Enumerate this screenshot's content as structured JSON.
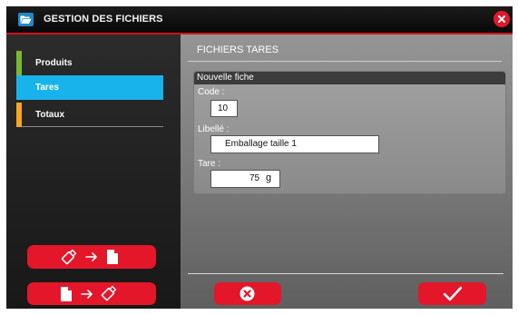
{
  "window": {
    "title": "GESTION DES FICHIERS",
    "icon": "folder-open-icon",
    "close_icon": "close-icon"
  },
  "sidebar": {
    "items": [
      {
        "label": "Produits",
        "accent": "#7ab82f",
        "active": false
      },
      {
        "label": "Tares",
        "accent": "#18b3eb",
        "active": true
      },
      {
        "label": "Totaux",
        "accent": "#f5a623",
        "active": false
      }
    ],
    "buttons": [
      {
        "name": "import-from-usb",
        "icons": [
          "usb-stick-icon",
          "arrow-right-icon",
          "document-icon"
        ]
      },
      {
        "name": "export-to-usb",
        "icons": [
          "document-icon",
          "arrow-right-icon",
          "usb-stick-icon"
        ]
      }
    ]
  },
  "main": {
    "section_title": "FICHIERS TARES",
    "card": {
      "header": "Nouvelle fiche",
      "code_label": "Code :",
      "code_value": "10",
      "libelle_label": "Libellé :",
      "libelle_value": "Emballage taille 1",
      "tare_label": "Tare :",
      "tare_value": "75",
      "tare_unit": "g"
    },
    "actions": {
      "cancel_icon": "cancel-circle-x-icon",
      "confirm_icon": "checkmark-icon"
    }
  },
  "colors": {
    "accent_red": "#e3162a",
    "active_blue": "#18b3eb",
    "produits_green": "#7ab82f",
    "totaux_orange": "#f5a623"
  }
}
